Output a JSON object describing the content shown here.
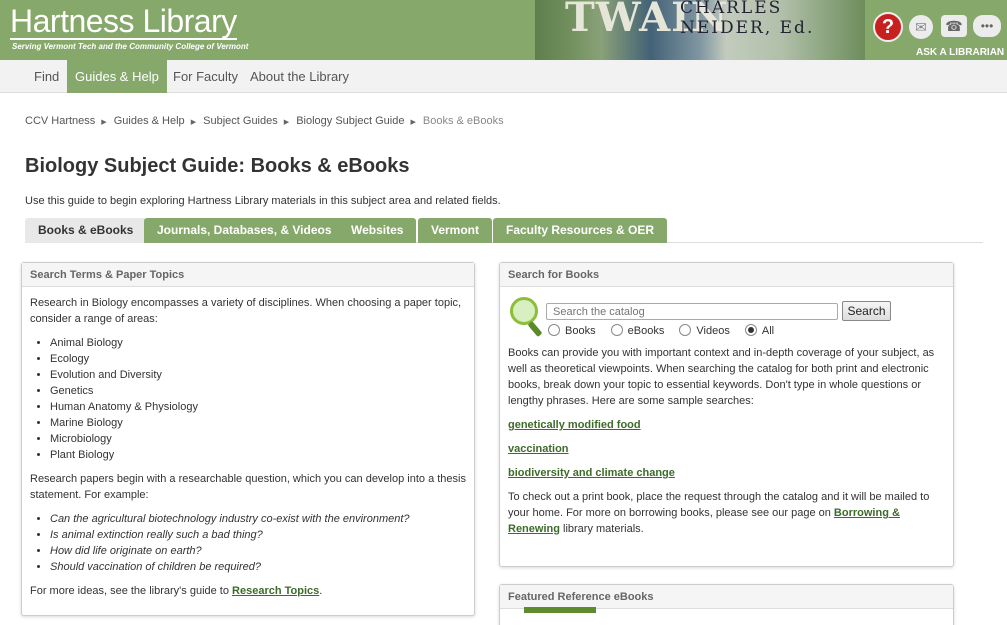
{
  "header": {
    "title": "Hartness Library",
    "subtitle": "Serving Vermont Tech and the Community College of Vermont",
    "banner_text_1": "TWAIN",
    "banner_text_2": "CHARLES",
    "banner_text_3": "NEIDER, Ed.",
    "ask_librarian": "ASK A LIBRARIAN",
    "icons": [
      "help-icon",
      "mail-icon",
      "phone-icon",
      "chat-icon"
    ],
    "help_glyph": "?",
    "colors": {
      "brand_green": "#86a86a",
      "help_red": "#c8201f"
    }
  },
  "nav": {
    "items": [
      {
        "label": "Find"
      },
      {
        "label": "Guides & Help"
      },
      {
        "label": "For Faculty"
      },
      {
        "label": "About the Library"
      }
    ],
    "active": "Guides & Help"
  },
  "breadcrumb": [
    "CCV Hartness",
    "Guides & Help",
    "Subject Guides",
    "Biology Subject Guide",
    "Books & eBooks"
  ],
  "page": {
    "title": "Biology Subject Guide: Books & eBooks",
    "intro": "Use this guide to begin exploring Hartness Library materials in this subject area and related fields."
  },
  "tabs": [
    {
      "label": "Books & eBooks",
      "active": true
    },
    {
      "label": "Journals, Databases, & Videos"
    },
    {
      "label": "Websites"
    },
    {
      "label": "Vermont"
    },
    {
      "label": "Faculty Resources & OER"
    }
  ],
  "left_panel": {
    "heading": "Search Terms & Paper Topics",
    "p1": "Research in Biology encompasses a variety of disciplines. When choosing a paper topic, consider a range of  areas:",
    "areas": [
      "Animal Biology",
      "Ecology",
      "Evolution and Diversity",
      "Genetics",
      "Human Anatomy & Physiology",
      "Marine Biology",
      "Microbiology",
      "Plant Biology"
    ],
    "p2": "Research papers begin with a researchable question, which you can develop into a thesis statement. For example:",
    "questions": [
      "Can the agricultural biotechnology industry co-exist with the environment?",
      "Is animal extinction really such a bad thing?",
      "How did life originate on earth?",
      "Should vaccination of children be required?"
    ],
    "p3_prefix": "For more ideas, see the library's guide to ",
    "p3_link": "Research Topics",
    "p3_suffix": "."
  },
  "right_panel": {
    "heading": "Search for Books",
    "search_placeholder": "Search the catalog",
    "search_button": "Search",
    "radios": [
      {
        "label": "Books",
        "checked": false
      },
      {
        "label": "eBooks",
        "checked": false
      },
      {
        "label": "Videos",
        "checked": false
      },
      {
        "label": "All",
        "checked": true
      }
    ],
    "p1": "Books can provide you with important context and in-depth coverage of your subject, as well as theoretical viewpoints. When searching the catalog for both print and electronic books, break down your topic to essential keywords. Don't type in whole questions or lengthy phrases. Here are some sample searches:",
    "samples": [
      "genetically modified food",
      "vaccination",
      "biodiversity and climate change"
    ],
    "p2_prefix": "To check out a print book, place the request through the catalog and it will be mailed to your home. For more on borrowing books, please see our page on ",
    "p2_link": "Borrowing & Renewing",
    "p2_suffix": " library materials."
  },
  "featured_panel": {
    "heading": "Featured Reference eBooks"
  }
}
